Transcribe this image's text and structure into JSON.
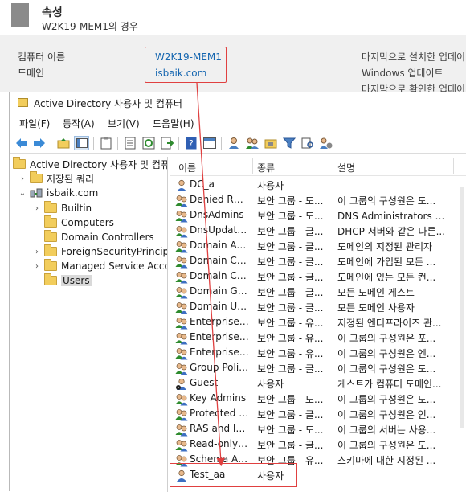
{
  "properties": {
    "title": "속성",
    "subtitle": "W2K19-MEM1의 경우",
    "computer_name_label": "컴퓨터 이름",
    "domain_label": "도메인",
    "computer_name_value": "W2K19-MEM1",
    "domain_value": "isbaik.com",
    "right_1": "마지막으로 설치한 업데이",
    "right_2": "Windows 업데이트",
    "right_3": "마지막으로 확인한 업데이"
  },
  "aduc": {
    "title": "Active Directory 사용자 및 컴퓨터",
    "menu": [
      "파일(F)",
      "동작(A)",
      "보기(V)",
      "도움말(H)"
    ],
    "tree": {
      "root": "Active Directory 사용자 및 컴퓨터",
      "saved_queries": "저장된 쿼리",
      "domain": "isbaik.com",
      "builtin": "Builtin",
      "computers": "Computers",
      "domain_controllers": "Domain Controllers",
      "foreign": "ForeignSecurityPrincipal",
      "managed": "Managed Service Accou",
      "users": "Users"
    },
    "columns": {
      "name": "이름",
      "type": "종류",
      "desc": "설명"
    },
    "rows": [
      {
        "name": "DC_a",
        "type": "사용자",
        "desc": "",
        "icon": "user"
      },
      {
        "name": "Denied ROD...",
        "type": "보안 그룹 - 도...",
        "desc": "이 그룹의 구성원은 도...",
        "icon": "group"
      },
      {
        "name": "DnsAdmins",
        "type": "보안 그룹 - 도...",
        "desc": "DNS Administrators 그룹",
        "icon": "group"
      },
      {
        "name": "DnsUpdateP...",
        "type": "보안 그룹 - 글...",
        "desc": "DHCP 서버와 같은 다른...",
        "icon": "group"
      },
      {
        "name": "Domain Ad...",
        "type": "보안 그룹 - 글...",
        "desc": "도메인의 지정된 관리자",
        "icon": "group"
      },
      {
        "name": "Domain Co...",
        "type": "보안 그룹 - 글...",
        "desc": "도메인에 가입된 모든 ...",
        "icon": "group"
      },
      {
        "name": "Domain Co...",
        "type": "보안 그룹 - 글...",
        "desc": "도메인에 있는 모든 컨...",
        "icon": "group"
      },
      {
        "name": "Domain Gu...",
        "type": "보안 그룹 - 글...",
        "desc": "모든 도메인 게스트",
        "icon": "group"
      },
      {
        "name": "Domain Users",
        "type": "보안 그룹 - 글...",
        "desc": "모든 도메인 사용자",
        "icon": "group"
      },
      {
        "name": "Enterprise A...",
        "type": "보안 그룹 - 유...",
        "desc": "지정된 엔터프라이즈 관...",
        "icon": "group"
      },
      {
        "name": "Enterprise K...",
        "type": "보안 그룹 - 유...",
        "desc": "이 그룹의 구성원은 포...",
        "icon": "group"
      },
      {
        "name": "Enterprise R...",
        "type": "보안 그룹 - 유...",
        "desc": "이 그룹의 구성원은 엔...",
        "icon": "group"
      },
      {
        "name": "Group Polic...",
        "type": "보안 그룹 - 글...",
        "desc": "이 그룹의 구성원은 도...",
        "icon": "group"
      },
      {
        "name": "Guest",
        "type": "사용자",
        "desc": "게스트가 컴퓨터 도메인...",
        "icon": "user-disabled"
      },
      {
        "name": "Key Admins",
        "type": "보안 그룹 - 도...",
        "desc": "이 그룹의 구성원은 도...",
        "icon": "group"
      },
      {
        "name": "Protected U...",
        "type": "보안 그룹 - 글...",
        "desc": "이 그룹의 구성원은 인...",
        "icon": "group"
      },
      {
        "name": "RAS and IA...",
        "type": "보안 그룹 - 도...",
        "desc": "이 그룹의 서버는 사용...",
        "icon": "group"
      },
      {
        "name": "Read-only D...",
        "type": "보안 그룹 - 글...",
        "desc": "이 그룹의 구성원은 도...",
        "icon": "group"
      },
      {
        "name": "Schema Ad...",
        "type": "보안 그룹 - 유...",
        "desc": "스키마에 대한 지정된 ...",
        "icon": "group"
      },
      {
        "name": "Test_aa",
        "type": "사용자",
        "desc": "",
        "icon": "user"
      }
    ]
  },
  "colors": {
    "annotation": "#e04040",
    "link": "#1566b0",
    "folder": "#f2cd5c"
  }
}
